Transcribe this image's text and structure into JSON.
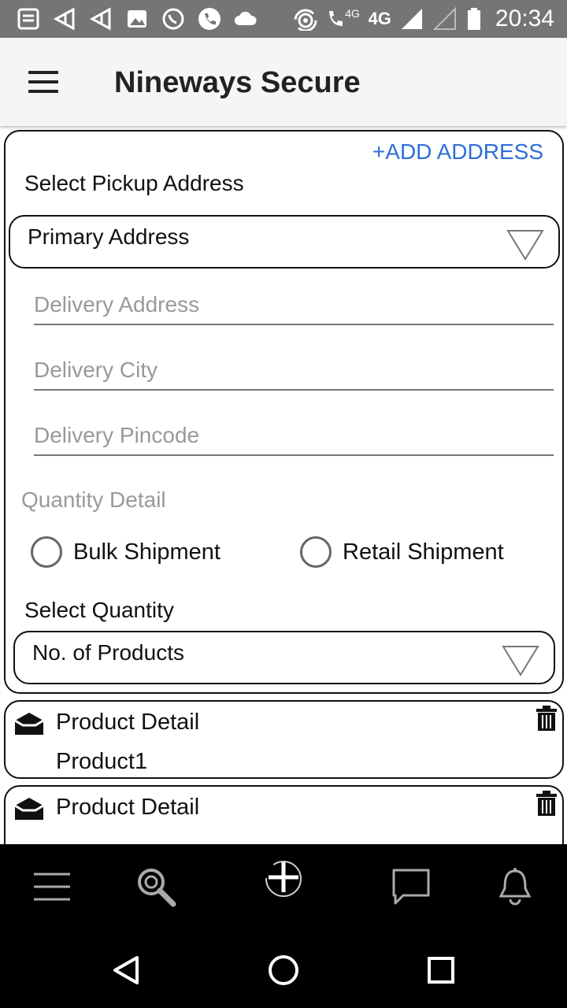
{
  "status_bar": {
    "network": "4G",
    "network_small": "4G",
    "time": "20:34"
  },
  "app_bar": {
    "title": "Nineways Secure",
    "menu_icon": "hamburger-icon"
  },
  "form": {
    "add_address_label": "+ADD ADDRESS",
    "pickup_label": "Select Pickup Address",
    "pickup_selected": "Primary Address",
    "delivery_address_placeholder": "Delivery Address",
    "delivery_city_placeholder": "Delivery City",
    "delivery_pincode_placeholder": "Delivery Pincode",
    "quantity_detail_label": "Quantity Detail",
    "radio_bulk": "Bulk Shipment",
    "radio_retail": "Retail Shipment",
    "select_quantity_label": "Select Quantity",
    "quantity_selected": "No. of Products"
  },
  "products": [
    {
      "title": "Product Detail",
      "name": "Product1"
    },
    {
      "title": "Product Detail",
      "name": ""
    }
  ],
  "bottom_nav": {
    "items": [
      "menu-icon",
      "search-icon",
      "add-icon",
      "chat-icon",
      "bell-icon"
    ]
  },
  "colors": {
    "accent": "#2f6fd6",
    "status_bar": "#757575",
    "app_bar": "#f5f5f5"
  }
}
